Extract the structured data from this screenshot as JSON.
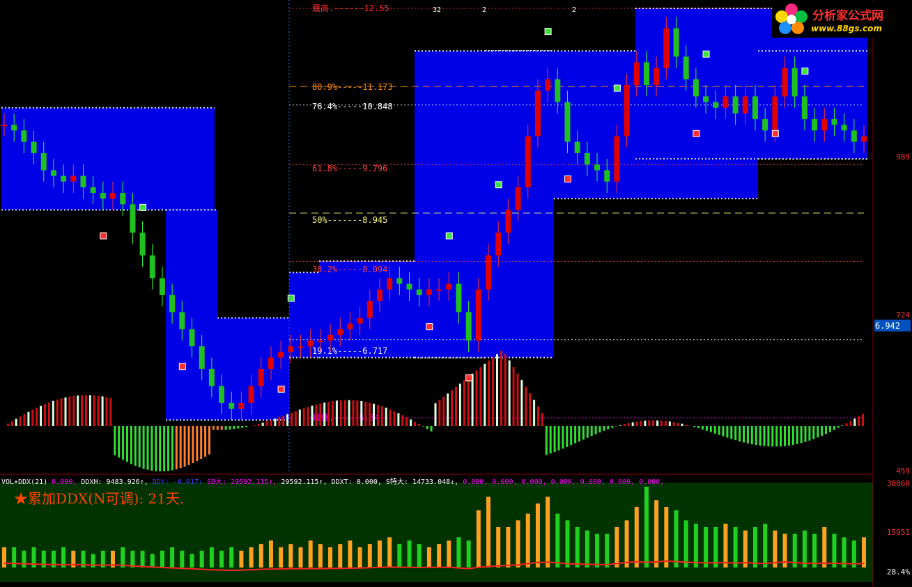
{
  "logo": {
    "name": "分析家公式网",
    "url": "www.88gs.com"
  },
  "price_axis": {
    "ticks": [
      "989",
      "724",
      "459"
    ],
    "current": "6.942"
  },
  "volume_axis": {
    "ticks": [
      "38060",
      "15951"
    ],
    "pct": "28.4%"
  },
  "fib_levels": [
    {
      "label": "最高.------12.55",
      "price": 12.55,
      "color": "#ff3030"
    },
    {
      "label": "80.9%-----11.173",
      "price": 11.173,
      "color": "#ff8c00"
    },
    {
      "label": "76.4%-----10.848",
      "price": 10.848,
      "color": "#ffffff"
    },
    {
      "label": "61.8%-----9.796",
      "price": 9.796,
      "color": "#ff4040"
    },
    {
      "label": "50%-------8.945",
      "price": 8.945,
      "color": "#ffff80"
    },
    {
      "label": "38.2%-----8.094",
      "price": 8.094,
      "color": "#ff4040"
    },
    {
      "label": "19.1%-----6.717",
      "price": 6.717,
      "color": "#ffffff"
    },
    {
      "label": "最低.-----5.34",
      "price": 5.34,
      "color": "#ff00ff"
    }
  ],
  "top_marks": [
    "32",
    "2",
    "2"
  ],
  "indicator": {
    "title": "★累加DDX(N可调): 21天.",
    "bar": [
      {
        "text": "VOL+DDX(21)",
        "color": "#ffffff"
      },
      {
        "text": " 0.000,",
        "color": "#ff00ff"
      },
      {
        "text": " DDXH: 9483.926↑,",
        "color": "#ffffff"
      },
      {
        "text": " DDY: -0.017↓",
        "color": "#4040ff"
      },
      {
        "text": "  SD大: 29592.115↑,",
        "color": "#ff00ff"
      },
      {
        "text": " 29592.115↑,",
        "color": "#ffffff"
      },
      {
        "text": "  DDXT: 0.000,",
        "color": "#ffffff"
      },
      {
        "text": " S特大: 14733.048↓,",
        "color": "#ffffff"
      },
      {
        "text": " 0.000, 0.000, 0.000, 0.000, 0.000, 0.000, 0.000,",
        "color": "#ff00ff"
      }
    ]
  },
  "chart_data": {
    "type": "candlestick+bar",
    "price_high": 12.55,
    "price_low": 5.34,
    "fib_retracement": [
      12.55,
      11.173,
      10.848,
      9.796,
      8.945,
      8.094,
      6.717,
      5.34
    ],
    "box_segments": [
      {
        "lo": 9.0,
        "hi": 10.8
      },
      {
        "lo": 5.3,
        "hi": 9.0
      },
      {
        "lo": 5.3,
        "hi": 7.1
      },
      {
        "lo": 6.4,
        "hi": 7.9
      },
      {
        "lo": 6.4,
        "hi": 8.1
      },
      {
        "lo": 8.1,
        "hi": 11.8
      },
      {
        "lo": 6.4,
        "hi": 11.8
      },
      {
        "lo": 9.2,
        "hi": 11.8
      },
      {
        "lo": 9.9,
        "hi": 12.55
      },
      {
        "lo": 9.9,
        "hi": 11.8
      }
    ],
    "close": [
      10.5,
      10.4,
      10.2,
      10.0,
      9.7,
      9.6,
      9.5,
      9.6,
      9.4,
      9.3,
      9.2,
      9.3,
      9.1,
      8.6,
      8.2,
      7.8,
      7.5,
      7.2,
      6.9,
      6.6,
      6.2,
      5.9,
      5.6,
      5.5,
      5.6,
      5.9,
      6.2,
      6.4,
      6.5,
      6.6,
      6.6,
      6.7,
      6.7,
      6.8,
      6.9,
      7.0,
      7.1,
      7.4,
      7.6,
      7.8,
      7.7,
      7.6,
      7.5,
      7.6,
      7.6,
      7.7,
      7.2,
      6.7,
      7.6,
      8.2,
      8.6,
      9.0,
      9.4,
      10.3,
      11.1,
      11.3,
      10.9,
      10.2,
      10.0,
      9.8,
      9.7,
      9.5,
      10.3,
      11.2,
      11.6,
      11.2,
      11.5,
      12.2,
      11.7,
      11.3,
      11.0,
      10.9,
      10.8,
      11.0,
      10.7,
      11.0,
      10.6,
      10.4,
      11.0,
      11.5,
      11.0,
      10.6,
      10.4,
      10.6,
      10.5,
      10.4,
      10.2,
      10.3
    ],
    "volume": [
      6,
      6,
      5,
      6,
      5,
      5,
      6,
      5,
      5,
      4,
      5,
      5,
      6,
      5,
      5,
      4,
      5,
      6,
      5,
      4,
      5,
      6,
      5,
      6,
      5,
      6,
      7,
      8,
      6,
      7,
      6,
      8,
      7,
      6,
      7,
      8,
      6,
      7,
      8,
      9,
      7,
      8,
      7,
      6,
      7,
      8,
      9,
      8,
      17,
      21,
      12,
      12,
      14,
      16,
      19,
      21,
      16,
      14,
      12,
      11,
      10,
      10,
      12,
      14,
      18,
      24,
      20,
      18,
      17,
      14,
      13,
      12,
      12,
      13,
      12,
      11,
      12,
      13,
      11,
      10,
      10,
      11,
      10,
      12,
      10,
      9,
      8,
      9
    ],
    "ylim": [
      4.59,
      12.9
    ],
    "volume_ylim": [
      0,
      38060
    ]
  }
}
